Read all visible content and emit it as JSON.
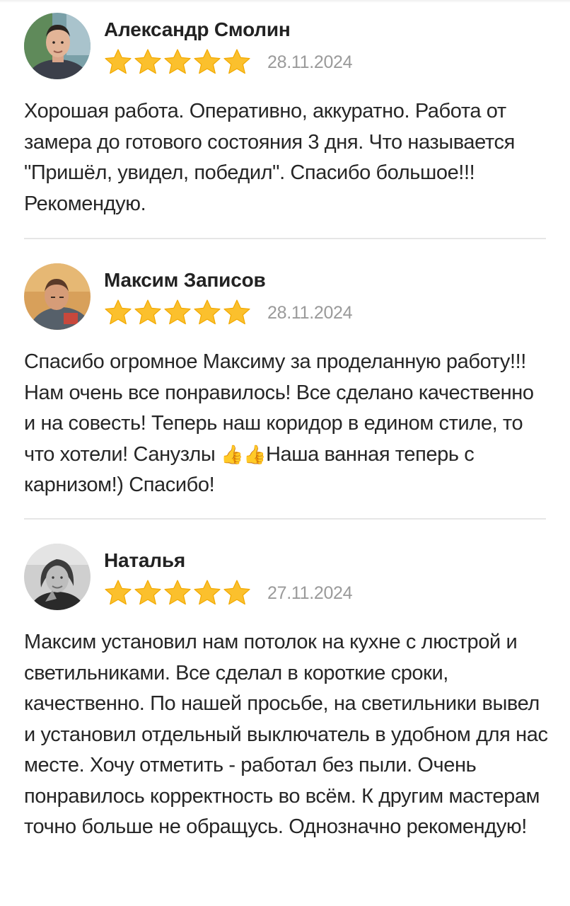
{
  "reviews": [
    {
      "author": "Александр Смолин",
      "rating": 5,
      "date": "28.11.2024",
      "text": "Хорошая работа. Оперативно, аккуратно. Работа от замера до готового состояния 3 дня. Что называется \"Пришёл, увидел, победил\". Спасибо большое!!! Рекомендую."
    },
    {
      "author": "Максим Записов",
      "rating": 5,
      "date": "28.11.2024",
      "text_before_emoji": "Спасибо огромное Максиму за проделанную работу!!! Нам очень все понравилось! Все сделано качественно и на совесть! Теперь наш коридор в едином стиле, то что хотели! Санузлы ",
      "emoji": "👍👍",
      "text_after_emoji": "Наша ванная теперь с карнизом!) Спасибо!"
    },
    {
      "author": "Наталья",
      "rating": 5,
      "date": "27.11.2024",
      "text": "Максим установил нам потолок на кухне с люстрой и светильниками. Все сделал в короткие сроки, качественно. По нашей просьбе, на светильники вывел и установил отдельный выключатель в удобном для нас месте. Хочу отметить - работал без пыли. Очень понравилось корректность во всём. К другим мастерам точно больше не обращусь. Однозначно рекомендую!"
    }
  ],
  "colors": {
    "star": "#fbc02d",
    "star_outline": "#f2a900",
    "divider": "#e6e6e6",
    "date": "#9a9a9a"
  },
  "icons": {
    "star": "star-icon",
    "thumbs_up": "thumbs-up-icon"
  }
}
